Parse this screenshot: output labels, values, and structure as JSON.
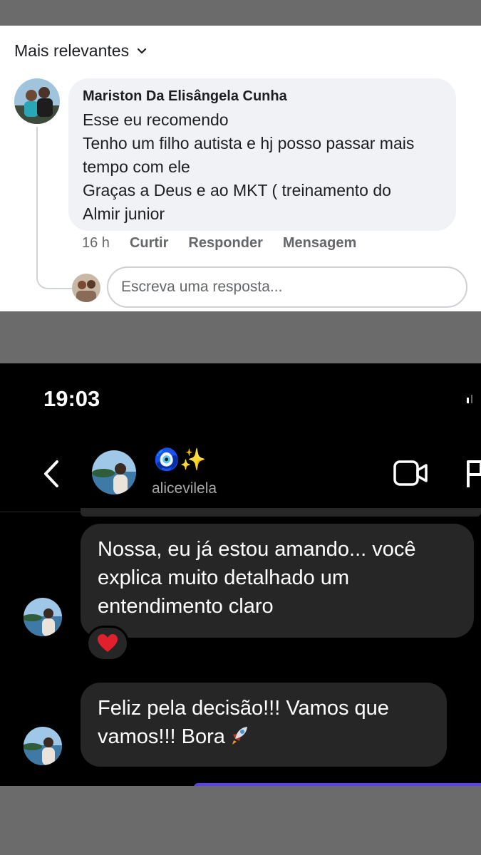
{
  "facebook": {
    "sort_label": "Mais relevantes",
    "comment": {
      "author": "Mariston Da Elisângela Cunha",
      "lines": [
        "Esse eu recomendo",
        "Tenho um filho autista e hj posso passar mais",
        "tempo com ele",
        "Graças a Deus e ao MKT ( treinamento do",
        "Almir junior"
      ],
      "time": "16 h",
      "actions": {
        "like": "Curtir",
        "reply": "Responder",
        "message": "Mensagem"
      }
    },
    "reply_placeholder": "Escreva uma resposta..."
  },
  "instagram": {
    "status_time": "19:03",
    "header": {
      "display_name": "🧿✨",
      "username": "alicevilela"
    },
    "messages": [
      {
        "lines": [
          "Nossa, eu já estou amando... você",
          "explica muito detalhado um",
          "entendimento claro"
        ],
        "reaction": "❤️"
      },
      {
        "lines": [
          "Feliz pela decisão!!! Vamos que",
          "vamos!!! Bora"
        ],
        "trailing_icon": "rocket-icon"
      }
    ],
    "colors": {
      "background": "#000000",
      "bubble": "#262626",
      "accent": "#5b3ff0"
    }
  }
}
